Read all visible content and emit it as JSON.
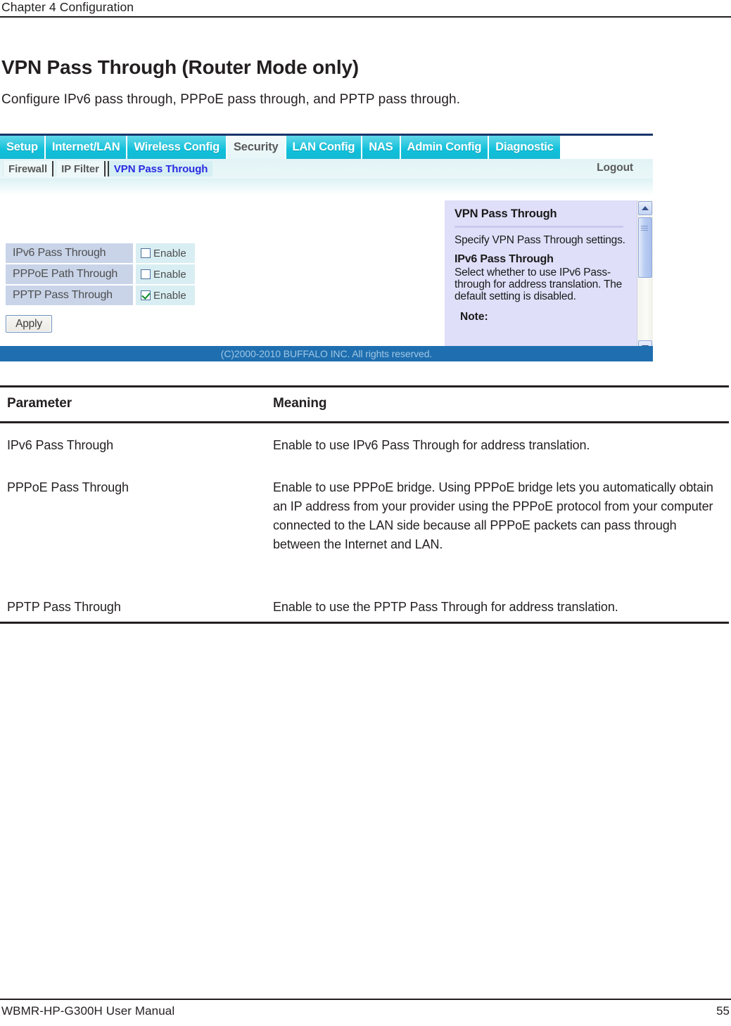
{
  "page_header": {
    "chapter": "Chapter 4  Configuration"
  },
  "heading": "VPN Pass Through (Router Mode only)",
  "intro": "Configure IPv6 pass through, PPPoE pass through, and PPTP pass through.",
  "screenshot": {
    "nav_tabs": [
      {
        "label": "Setup",
        "active": false
      },
      {
        "label": "Internet/LAN",
        "active": false
      },
      {
        "label": "Wireless Config",
        "active": false
      },
      {
        "label": "Security",
        "active": true
      },
      {
        "label": "LAN Config",
        "active": false
      },
      {
        "label": "NAS",
        "active": false
      },
      {
        "label": "Admin Config",
        "active": false
      },
      {
        "label": "Diagnostic",
        "active": false
      }
    ],
    "sub_tabs": [
      {
        "label": "Firewall",
        "active": false
      },
      {
        "label": "IP Filter",
        "active": false
      },
      {
        "label": "VPN Pass Through",
        "active": true
      }
    ],
    "logout_label": "Logout",
    "settings": [
      {
        "label": "IPv6 Pass Through",
        "checkbox_label": "Enable",
        "checked": false
      },
      {
        "label": "PPPoE Path Through",
        "checkbox_label": "Enable",
        "checked": false
      },
      {
        "label": "PPTP Pass Through",
        "checkbox_label": "Enable",
        "checked": true
      }
    ],
    "apply_label": "Apply",
    "help": {
      "title": "VPN Pass Through",
      "intro": "Specify VPN Pass Through settings.",
      "section_title": "IPv6 Pass Through",
      "section_text": "Select whether to use IPv6 Pass-through for address translation. The default setting is disabled.",
      "note_label": "Note:"
    },
    "copyright": "(C)2000-2010 BUFFALO INC. All rights reserved.",
    "colors": {
      "tab_cyan": "#16b9d4",
      "active_tab_link": "#2b2be0",
      "footer_blue": "#1f6fb0",
      "label_cell": "#c9d4e9",
      "control_cell": "#d8eef2",
      "help_panel": "#dfdffa",
      "check_green": "#0a8a2a"
    }
  },
  "table": {
    "headers": [
      "Parameter",
      "Meaning"
    ],
    "rows": [
      {
        "parameter": "IPv6 Pass Through",
        "meaning": "Enable to use IPv6 Pass Through for address translation."
      },
      {
        "parameter": "PPPoE Pass Through",
        "meaning": "Enable to use PPPoE bridge. Using PPPoE bridge lets you automatically obtain an IP address from your provider using the PPPoE protocol from your computer connected to the LAN side because all PPPoE packets can pass through between the Internet and LAN."
      },
      {
        "parameter": "PPTP Pass Through",
        "meaning": "Enable to use the PPTP Pass Through for address translation."
      }
    ]
  },
  "page_footer": {
    "manual": "WBMR-HP-G300H User Manual",
    "page_number": "55"
  }
}
